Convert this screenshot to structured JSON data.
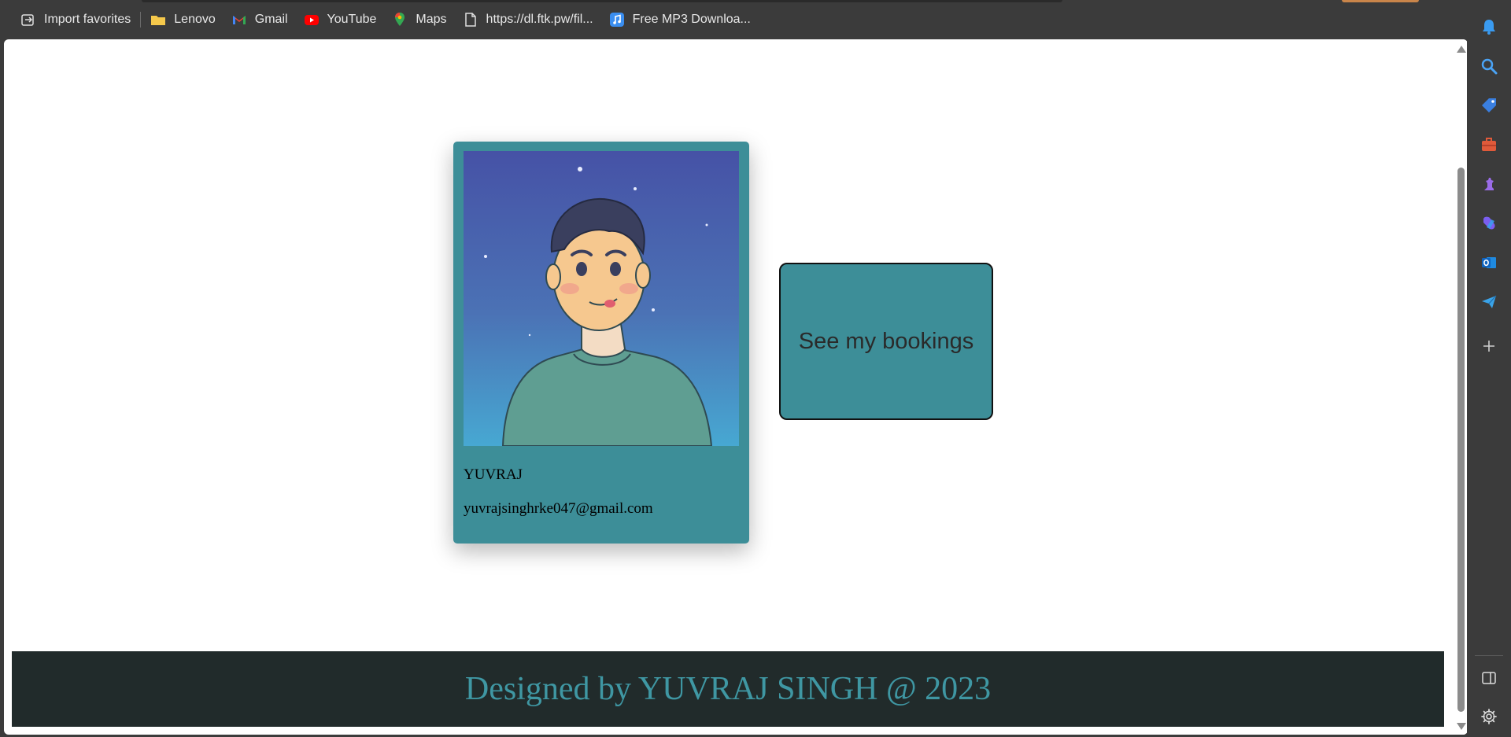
{
  "bookmarks": [
    {
      "label": "Import favorites",
      "icon": "import-icon"
    },
    {
      "label": "Lenovo",
      "icon": "folder-icon"
    },
    {
      "label": "Gmail",
      "icon": "gmail-icon"
    },
    {
      "label": "YouTube",
      "icon": "youtube-icon"
    },
    {
      "label": "Maps",
      "icon": "maps-icon"
    },
    {
      "label": "https://dl.ftk.pw/fil...",
      "icon": "file-icon"
    },
    {
      "label": "Free MP3 Downloa...",
      "icon": "music-icon"
    }
  ],
  "profile": {
    "name": "YUVRAJ",
    "email": "yuvrajsinghrke047@gmail.com",
    "avatar_icon": "avatar-illustration"
  },
  "actions": {
    "bookings_label": "See my bookings"
  },
  "footer": {
    "text": "Designed by YUVRAJ SINGH @ 2023"
  },
  "sidebar": {
    "icons": [
      "bell-icon",
      "search-icon",
      "tag-icon",
      "briefcase-icon",
      "chess-icon",
      "copilot-icon",
      "outlook-icon",
      "send-icon",
      "plus-icon",
      "split-view-icon",
      "settings-icon"
    ]
  },
  "colors": {
    "card": "#3d8e98",
    "footer_bg": "#212b2b",
    "footer_text": "#3f97a3",
    "chrome": "#3b3b3b"
  }
}
